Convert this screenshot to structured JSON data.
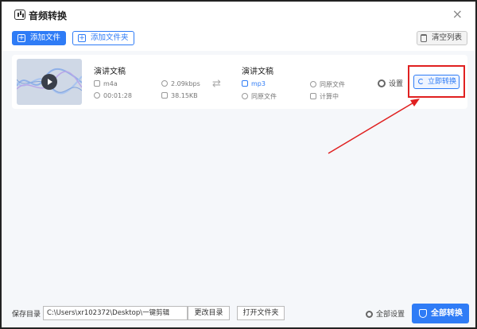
{
  "window": {
    "title": "音频转换",
    "close_glyph": "×"
  },
  "toolbar": {
    "add_file_label": "添加文件",
    "add_folder_label": "添加文件夹",
    "clear_list_label": "清空列表"
  },
  "task": {
    "source": {
      "name": "演讲文稿",
      "format": "m4a",
      "bitrate": "2.09kbps",
      "duration": "00:01:28",
      "size": "38.15KB"
    },
    "target": {
      "name": "演讲文稿",
      "format": "mp3",
      "quality": "同原文件",
      "size_note": "同原文件",
      "status": "计算中"
    },
    "settings_label": "设置",
    "convert_now_label": "立即转换"
  },
  "bottom": {
    "save_dir_label": "保存目录",
    "save_path": "C:\\Users\\xr102372\\Desktop\\一键剪辑",
    "change_dir_label": "更改目录",
    "open_folder_label": "打开文件夹",
    "all_settings_label": "全部设置",
    "convert_all_label": "全部转换"
  },
  "colors": {
    "accent": "#2f7cf6",
    "annotation": "#e02020",
    "background": "#f5f7fa"
  },
  "icons": {
    "app": "audio-convert-icon",
    "shuffle": "shuffle-icon",
    "gear": "gear-icon",
    "shield": "shield-icon"
  }
}
